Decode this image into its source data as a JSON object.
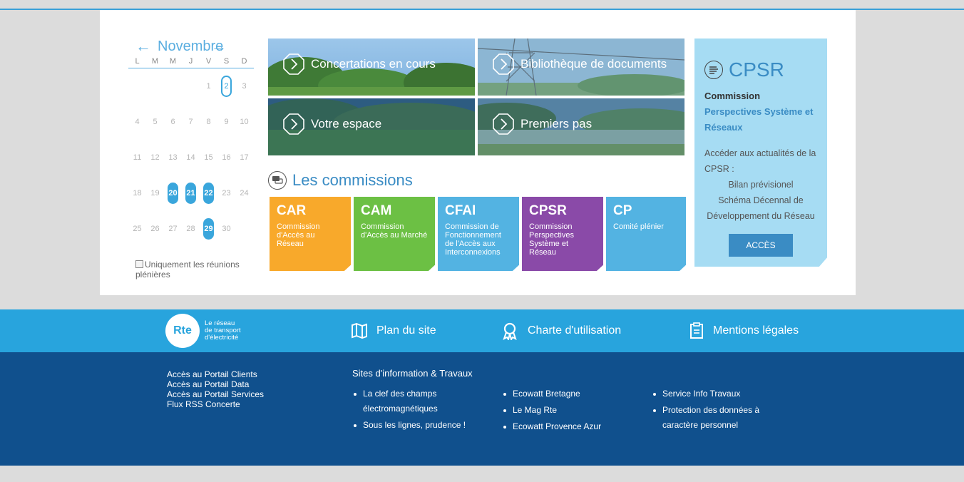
{
  "calendar": {
    "month": "Novembre",
    "weekdays": [
      "L",
      "M",
      "M",
      "J",
      "V",
      "S",
      "D"
    ],
    "weeks": [
      [
        "",
        "",
        "",
        "",
        "1",
        "2",
        "3"
      ],
      [
        "4",
        "5",
        "6",
        "7",
        "8",
        "9",
        "10"
      ],
      [
        "11",
        "12",
        "13",
        "14",
        "15",
        "16",
        "17"
      ],
      [
        "18",
        "19",
        "20",
        "21",
        "22",
        "23",
        "24"
      ],
      [
        "25",
        "26",
        "27",
        "28",
        "29",
        "30",
        ""
      ]
    ],
    "event_days": [
      "20",
      "21",
      "22",
      "29"
    ],
    "today": "2",
    "checkbox_label": "Uniquement les réunions plénières",
    "accent": "#3aa6dc"
  },
  "tiles": {
    "t1": "Concertations en cours",
    "t2": "Bibliothèque de documents",
    "t3": "Votre espace",
    "t4": "Premiers pas"
  },
  "commissions": {
    "title": "Les commissions",
    "cards": [
      {
        "abbr": "CAR",
        "desc": "Commission d'Accès au Réseau",
        "color": "#f8a92b"
      },
      {
        "abbr": "CAM",
        "desc": "Commission d'Accès au Marché",
        "color": "#6cc044"
      },
      {
        "abbr": "CFAI",
        "desc": "Commission de Fonctionnement de l'Accès aux Interconnexions",
        "color": "#53b3e2"
      },
      {
        "abbr": "CPSR",
        "desc": "Commission Perspectives Système et Réseau",
        "color": "#8a4aa8"
      },
      {
        "abbr": "CP",
        "desc": "Comité plénier",
        "color": "#53b3e2"
      }
    ]
  },
  "cpsr": {
    "title": "CPSR",
    "sub_a": "Commission",
    "sub_b": "Perspectives Système et Réseaux",
    "text": "Accéder aux actualités de la CPSR :",
    "line1": "Bilan prévisionel",
    "line2": "Schéma Décennal de Développement du Réseau",
    "button": "ACCÈS"
  },
  "footer": {
    "logo_text": "Rte",
    "logo_tag_1": "Le réseau",
    "logo_tag_2": "de transport",
    "logo_tag_3": "d'électricité",
    "plan": "Plan du site",
    "charte": "Charte d'utilisation",
    "mentions": "Mentions légales",
    "portal_links": [
      "Accès au Portail Clients",
      "Accès au Portail Data",
      "Accès au Portail Services",
      "Flux RSS Concerte"
    ],
    "sites_title": "Sites d'information & Travaux",
    "col1": [
      "La clef des champs électromagnétiques",
      "Sous les lignes, prudence !"
    ],
    "col2": [
      "Ecowatt Bretagne",
      "Le Mag Rte",
      "Ecowatt Provence Azur"
    ],
    "col3": [
      "Service Info Travaux",
      "Protection des données à caractère personnel"
    ]
  }
}
